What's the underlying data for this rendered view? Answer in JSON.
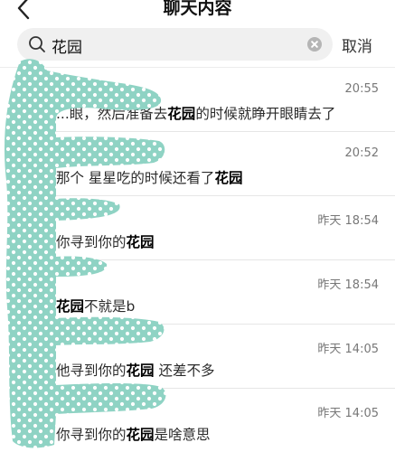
{
  "header": {
    "title": "聊天内容"
  },
  "search": {
    "query": "花园",
    "cancel_label": "取消"
  },
  "results": [
    {
      "time": "20:55",
      "pre": "...眼，然后准备去",
      "hl": "花园",
      "post": "的时候就睁开眼睛去了"
    },
    {
      "time": "20:52",
      "pre": "那个 星星吃的时候还看了",
      "hl": "花园",
      "post": ""
    },
    {
      "time": "昨天 18:54",
      "pre": "你寻到你的",
      "hl": "花园",
      "post": ""
    },
    {
      "time": "昨天 18:54",
      "pre": "",
      "hl": "花园",
      "post": "不就是b"
    },
    {
      "time": "昨天 14:05",
      "pre": "他寻到你的",
      "hl": "花园",
      "post": " 还差不多"
    },
    {
      "time": "昨天 14:05",
      "pre": "你寻到你的",
      "hl": "花园",
      "post": "是啥意思"
    }
  ],
  "colors": {
    "mask": "#8fd3c4",
    "mask_dots": "#ffffff"
  }
}
